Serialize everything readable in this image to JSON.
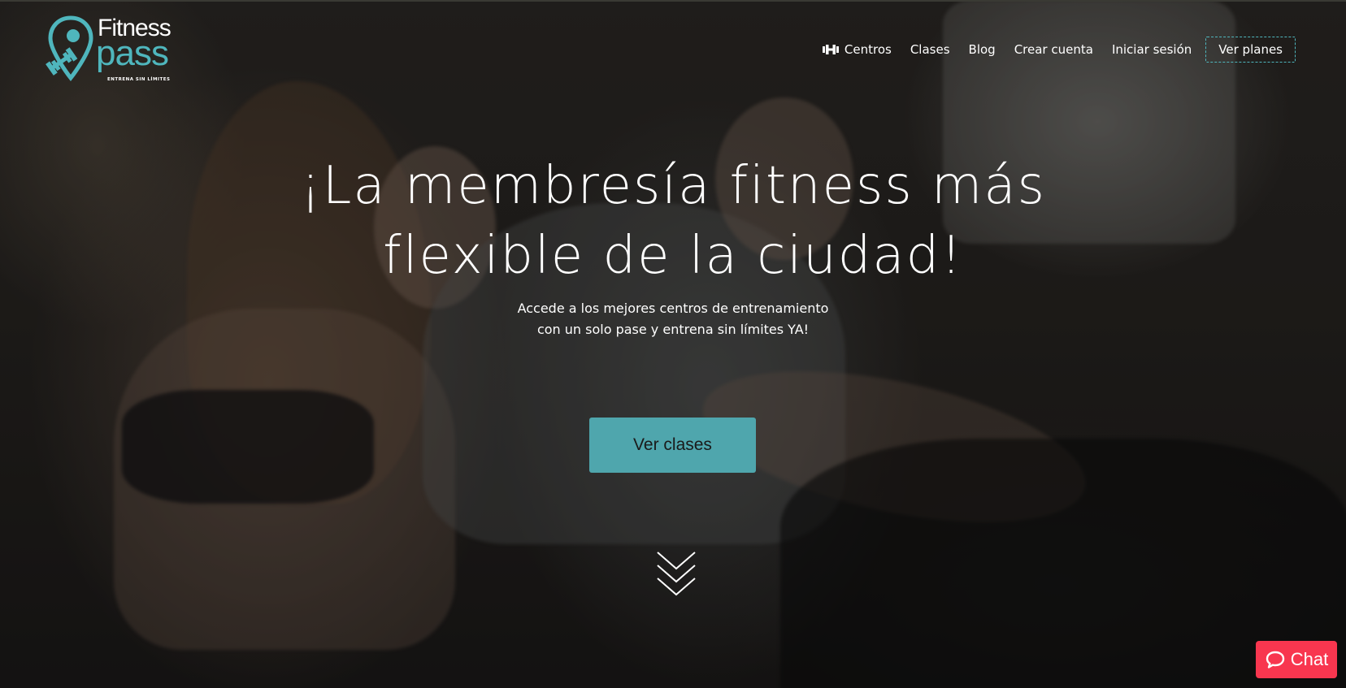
{
  "brand": {
    "name_top": "Fitness",
    "name_bottom": "pass",
    "tagline": "ENTRENA SIN LÍMITES",
    "color_accent": "#4fb6bd",
    "logo_icon": "map-pin-dumbbell-icon"
  },
  "nav": {
    "items": [
      {
        "label": "Centros",
        "icon": "dumbbell-icon"
      },
      {
        "label": "Clases"
      },
      {
        "label": "Blog"
      },
      {
        "label": "Crear cuenta"
      },
      {
        "label": "Iniciar sesión"
      }
    ],
    "plans_label": "Ver planes"
  },
  "hero": {
    "headline_line1": "¡La membresía fitness más",
    "headline_line2": "flexible de la ciudad!",
    "subtitle_line1": "Accede a los mejores centros de entrenamiento",
    "subtitle_line2": "con un solo pase y entrena sin límites YA!",
    "cta_label": "Ver clases",
    "cta_color": "#4fa6ad",
    "scroll_icon": "double-chevron-down-icon"
  },
  "chat": {
    "label": "Chat",
    "icon": "speech-bubble-icon",
    "color": "#f8364f"
  }
}
